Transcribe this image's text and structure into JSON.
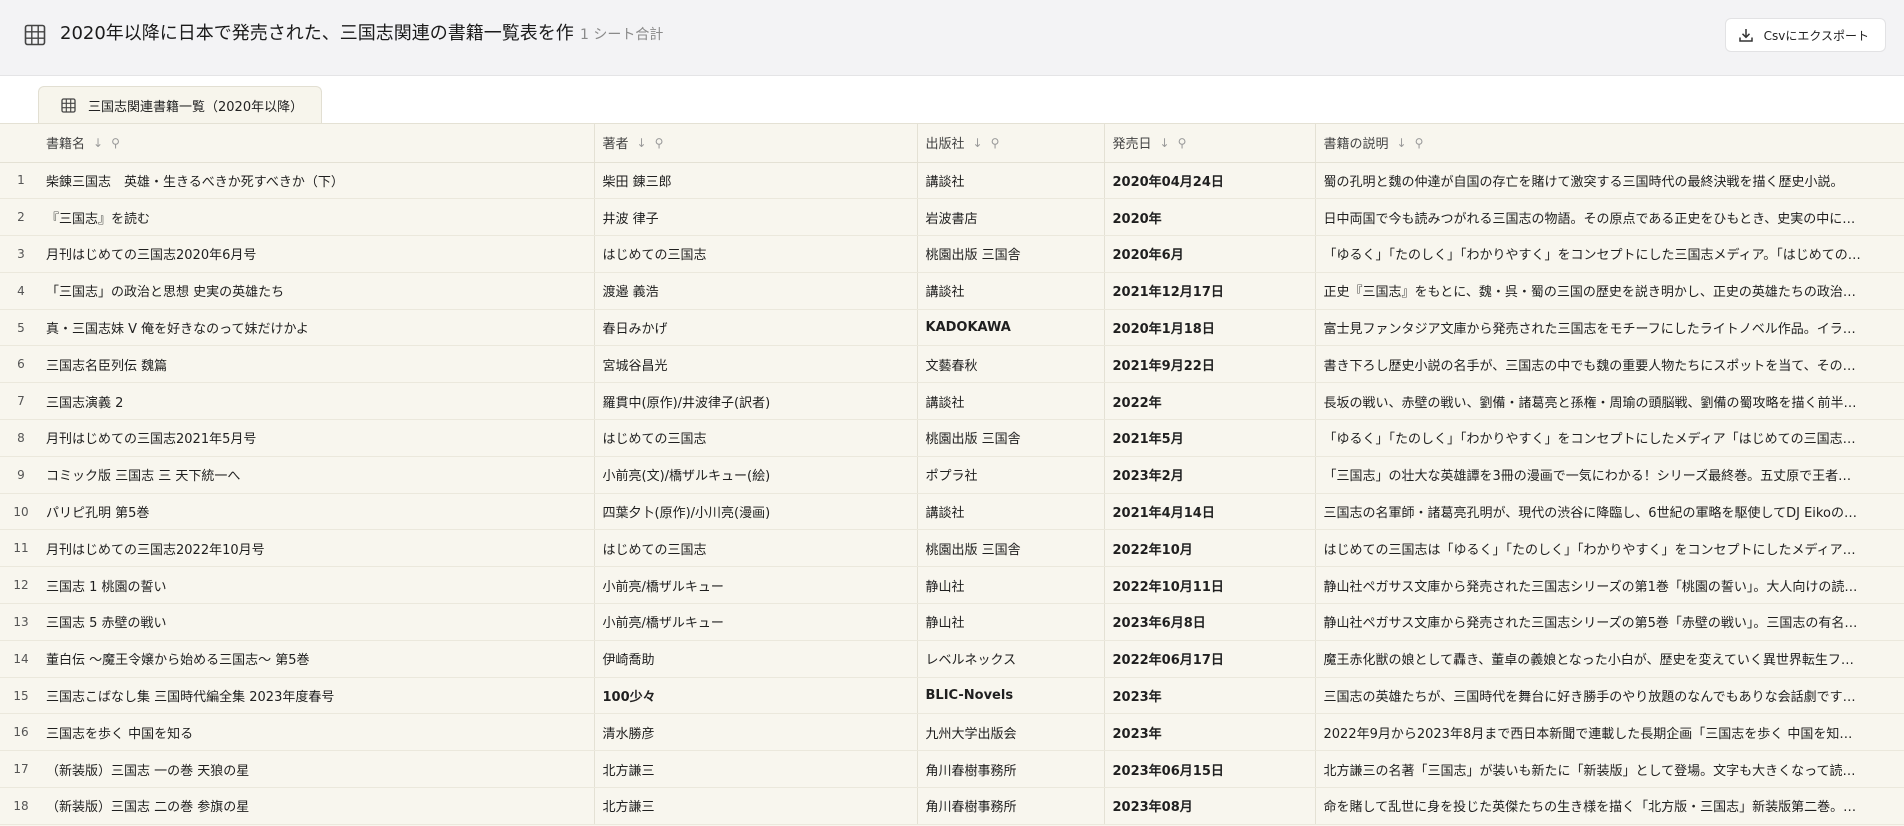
{
  "header": {
    "title": "2020年以降に日本で発売された、三国志関連の書籍一覧表を作",
    "subtitle": "1 シート合計",
    "export_label": "Csvにエクスポート",
    "icon": "grid-icon"
  },
  "tab": {
    "label": "三国志関連書籍一覧（2020年以降）",
    "icon": "grid-icon"
  },
  "columns": [
    {
      "label": "書籍名"
    },
    {
      "label": "著者"
    },
    {
      "label": "出版社"
    },
    {
      "label": "発売日"
    },
    {
      "label": "書籍の説明"
    }
  ],
  "rows": [
    {
      "num": "1",
      "title": "柴錬三国志　英雄・生きるべきか死すべきか（下）",
      "author": "柴田 錬三郎",
      "publisher": "講談社",
      "date": "2020年04月24日",
      "desc": "蜀の孔明と魏の仲達が自国の存亡を賭けて激突する三国時代の最終決戦を描く歴史小説。"
    },
    {
      "num": "2",
      "title": "『三国志』を読む",
      "author": "井波 律子",
      "publisher": "岩波書店",
      "date": "2020年",
      "desc": "日中両国で今も読みつがれる三国志の物語。その原点である正史をひもとき、史実の中に…"
    },
    {
      "num": "3",
      "title": "月刊はじめての三国志2020年6月号",
      "author": "はじめての三国志",
      "publisher": "桃園出版 三国舎",
      "date": "2020年6月",
      "desc": "「ゆるく」「たのしく」「わかりやすく」をコンセプトにした三国志メディア。「はじめての…"
    },
    {
      "num": "4",
      "title": "「三国志」の政治と思想 史実の英雄たち",
      "author": "渡邉 義浩",
      "publisher": "講談社",
      "date": "2021年12月17日",
      "desc": "正史『三国志』をもとに、魏・呉・蜀の三国の歴史を説き明かし、正史の英雄たちの政治…"
    },
    {
      "num": "5",
      "title": "真・三国志妹 V 俺を好きなのって妹だけかよ",
      "author": "春日みかげ",
      "publisher": "KADOKAWA",
      "date": "2020年1月18日",
      "desc": "富士見ファンタジア文庫から発売された三国志をモチーフにしたライトノベル作品。イラ…"
    },
    {
      "num": "6",
      "title": "三国志名臣列伝 魏篇",
      "author": "宮城谷昌光",
      "publisher": "文藝春秋",
      "date": "2021年9月22日",
      "desc": "書き下ろし歴史小説の名手が、三国志の中でも魏の重要人物たちにスポットを当て、その…"
    },
    {
      "num": "7",
      "title": "三国志演義 2",
      "author": "羅貫中(原作)/井波律子(訳者)",
      "publisher": "講談社",
      "date": "2022年",
      "desc": "長坂の戦い、赤壁の戦い、劉備・諸葛亮と孫権・周瑜の頭脳戦、劉備の蜀攻略を描く前半…"
    },
    {
      "num": "8",
      "title": "月刊はじめての三国志2021年5月号",
      "author": "はじめての三国志",
      "publisher": "桃園出版 三国舎",
      "date": "2021年5月",
      "desc": "「ゆるく」「たのしく」「わかりやすく」をコンセプトにしたメディア「はじめての三国志…"
    },
    {
      "num": "9",
      "title": "コミック版 三国志 三 天下統一へ",
      "author": "小前亮(文)/橋ザルキュー(絵)",
      "publisher": "ポプラ社",
      "date": "2023年2月",
      "desc": "「三国志」の壮大な英雄譚を3冊の漫画で一気にわかる！シリーズ最終巻。五丈原で王者…"
    },
    {
      "num": "10",
      "title": "パリピ孔明 第5巻",
      "author": "四葉夕卜(原作)/小川亮(漫画)",
      "publisher": "講談社",
      "date": "2021年4月14日",
      "desc": "三国志の名軍師・諸葛亮孔明が、現代の渋谷に降臨し、6世紀の軍略を駆使してDJ Eikoの…"
    },
    {
      "num": "11",
      "title": "月刊はじめての三国志2022年10月号",
      "author": "はじめての三国志",
      "publisher": "桃園出版 三国舎",
      "date": "2022年10月",
      "desc": "はじめての三国志は「ゆるく」「たのしく」「わかりやすく」をコンセプトにしたメディア…"
    },
    {
      "num": "12",
      "title": "三国志 1 桃園の誓い",
      "author": "小前亮/橋ザルキュー",
      "publisher": "静山社",
      "date": "2022年10月11日",
      "desc": "静山社ペガサス文庫から発売された三国志シリーズの第1巻「桃園の誓い」。大人向けの読…"
    },
    {
      "num": "13",
      "title": "三国志 5 赤壁の戦い",
      "author": "小前亮/橋ザルキュー",
      "publisher": "静山社",
      "date": "2023年6月8日",
      "desc": "静山社ペガサス文庫から発売された三国志シリーズの第5巻「赤壁の戦い」。三国志の有名…"
    },
    {
      "num": "14",
      "title": "董白伝 〜魔王令嬢から始める三国志〜 第5巻",
      "author": "伊崎喬助",
      "publisher": "レベルネックス",
      "date": "2022年06月17日",
      "desc": "魔王赤化獣の娘として轟き、董卓の義娘となった小白が、歴史を変えていく異世界転生フ…"
    },
    {
      "num": "15",
      "title": "三国志こばなし集 三国時代編全集 2023年度春号",
      "author": "100少々",
      "publisher": "BLIC-Novels",
      "date": "2023年",
      "desc": "三国志の英雄たちが、三国時代を舞台に好き勝手のやり放題のなんでもありな会話劇です…"
    },
    {
      "num": "16",
      "title": "三国志を歩く 中国を知る",
      "author": "清水勝彦",
      "publisher": "九州大学出版会",
      "date": "2023年",
      "desc": "2022年9月から2023年8月まで西日本新聞で連載した長期企画「三国志を歩く 中国を知…"
    },
    {
      "num": "17",
      "title": "（新装版）三国志 一の巻 天狼の星",
      "author": "北方謙三",
      "publisher": "角川春樹事務所",
      "date": "2023年06月15日",
      "desc": "北方謙三の名著「三国志」が装いも新たに「新装版」として登場。文字も大きくなって読…"
    },
    {
      "num": "18",
      "title": "（新装版）三国志 二の巻 参旗の星",
      "author": "北方謙三",
      "publisher": "角川春樹事務所",
      "date": "2023年08月",
      "desc": "命を賭して乱世に身を投じた英傑たちの生き様を描く「北方版・三国志」新装版第二巻。…"
    }
  ]
}
